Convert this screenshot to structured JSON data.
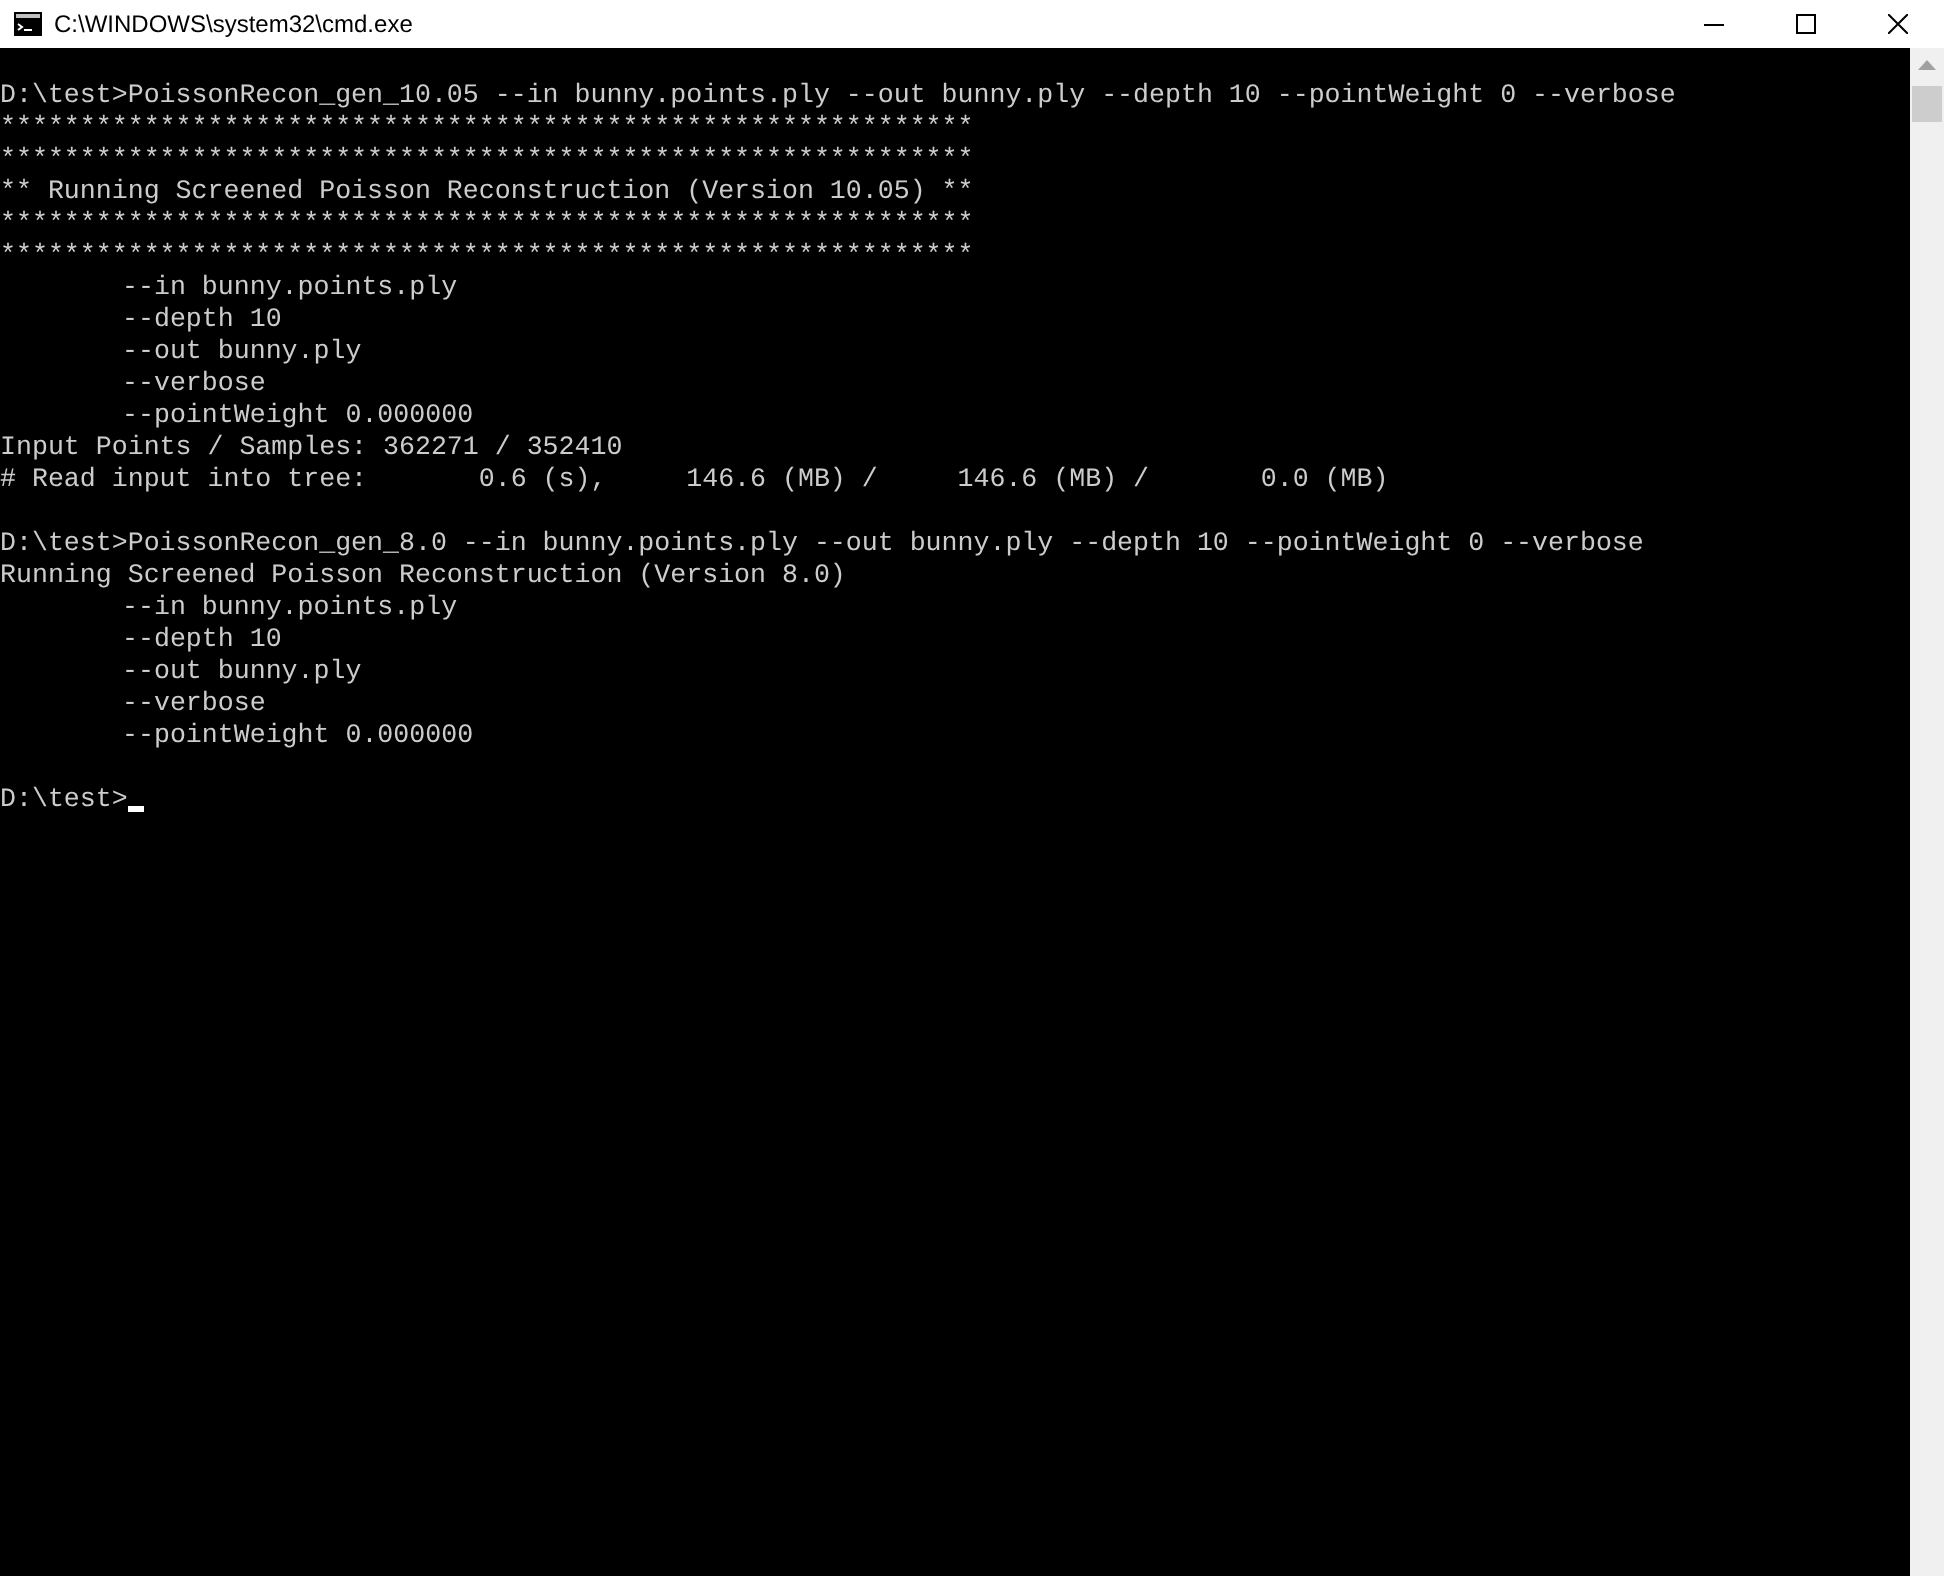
{
  "window": {
    "title": "C:\\WINDOWS\\system32\\cmd.exe"
  },
  "console": {
    "blocks": [
      {
        "lines": [
          {
            "kind": "command",
            "text": "D:\\test>PoissonRecon_gen_10.05 --in bunny.points.ply --out bunny.ply --depth 10 --pointWeight 0 --verbose"
          },
          {
            "kind": "output",
            "text": "*************************************************************"
          },
          {
            "kind": "output",
            "text": "*************************************************************"
          },
          {
            "kind": "output",
            "text": "** Running Screened Poisson Reconstruction (Version 10.05) **"
          },
          {
            "kind": "output",
            "text": "*************************************************************"
          },
          {
            "kind": "output",
            "text": "*************************************************************"
          },
          {
            "kind": "option",
            "text": "--in bunny.points.ply"
          },
          {
            "kind": "option",
            "text": "--depth 10"
          },
          {
            "kind": "option",
            "text": "--out bunny.ply"
          },
          {
            "kind": "option",
            "text": "--verbose"
          },
          {
            "kind": "option",
            "text": "--pointWeight 0.000000"
          },
          {
            "kind": "output",
            "text": "Input Points / Samples: 362271 / 352410"
          },
          {
            "kind": "output",
            "text": "# Read input into tree:       0.6 (s),     146.6 (MB) /     146.6 (MB) /       0.0 (MB)"
          }
        ]
      },
      {
        "lines": [
          {
            "kind": "command",
            "text": "D:\\test>PoissonRecon_gen_8.0 --in bunny.points.ply --out bunny.ply --depth 10 --pointWeight 0 --verbose"
          },
          {
            "kind": "output",
            "text": "Running Screened Poisson Reconstruction (Version 8.0)"
          },
          {
            "kind": "option",
            "text": "--in bunny.points.ply"
          },
          {
            "kind": "option",
            "text": "--depth 10"
          },
          {
            "kind": "option",
            "text": "--out bunny.ply"
          },
          {
            "kind": "option",
            "text": "--verbose"
          },
          {
            "kind": "option",
            "text": "--pointWeight 0.000000"
          }
        ]
      }
    ],
    "prompt": {
      "text": "D:\\test>",
      "cursor": true
    }
  }
}
